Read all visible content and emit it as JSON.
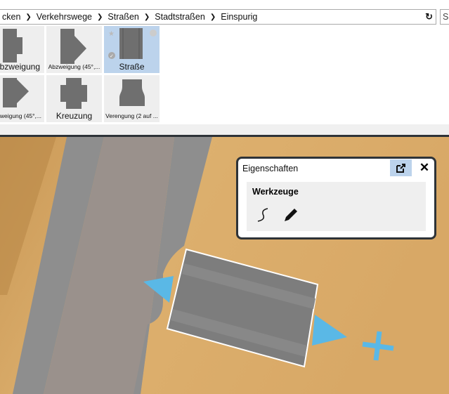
{
  "breadcrumb": {
    "items": [
      "cken",
      "Verkehrswege",
      "Straßen",
      "Stadtstraßen",
      "Einspurig"
    ]
  },
  "search": {
    "placeholder": "Su"
  },
  "tiles": [
    {
      "label": "Abzweigung",
      "display": "bzweigung"
    },
    {
      "label": "Abzweigung (45°,..."
    },
    {
      "label": "Straße"
    },
    {
      "label": "weigung (45°,..."
    },
    {
      "label": "Kreuzung"
    },
    {
      "label": "Verengung (2 auf ..."
    }
  ],
  "panel": {
    "title": "Eigenschaften",
    "section": "Werkzeuge",
    "tools": [
      "curve-tool",
      "pencil-tool"
    ]
  },
  "colors": {
    "selection": "#bcd3ec",
    "arrow": "#5ab8e6",
    "wood": "#d9a867"
  }
}
